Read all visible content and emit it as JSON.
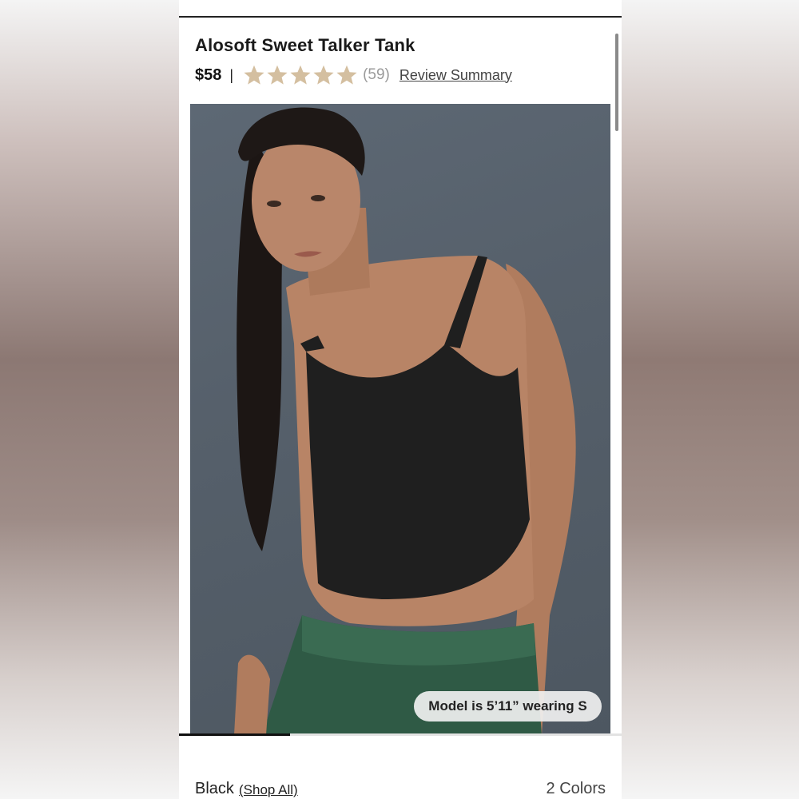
{
  "product": {
    "title": "Alosoft Sweet Talker Tank",
    "price": "$58",
    "separator": "|",
    "rating": 5,
    "review_count": "(59)",
    "review_summary_link": "Review Summary",
    "star_color": "#d4bfa0"
  },
  "gallery": {
    "model_info": "Model is 5’11” wearing S",
    "progress_fraction": 0.25
  },
  "color_selector": {
    "selected_color": "Black",
    "shop_all_link": "(Shop All)",
    "colors_count": "2 Colors"
  }
}
